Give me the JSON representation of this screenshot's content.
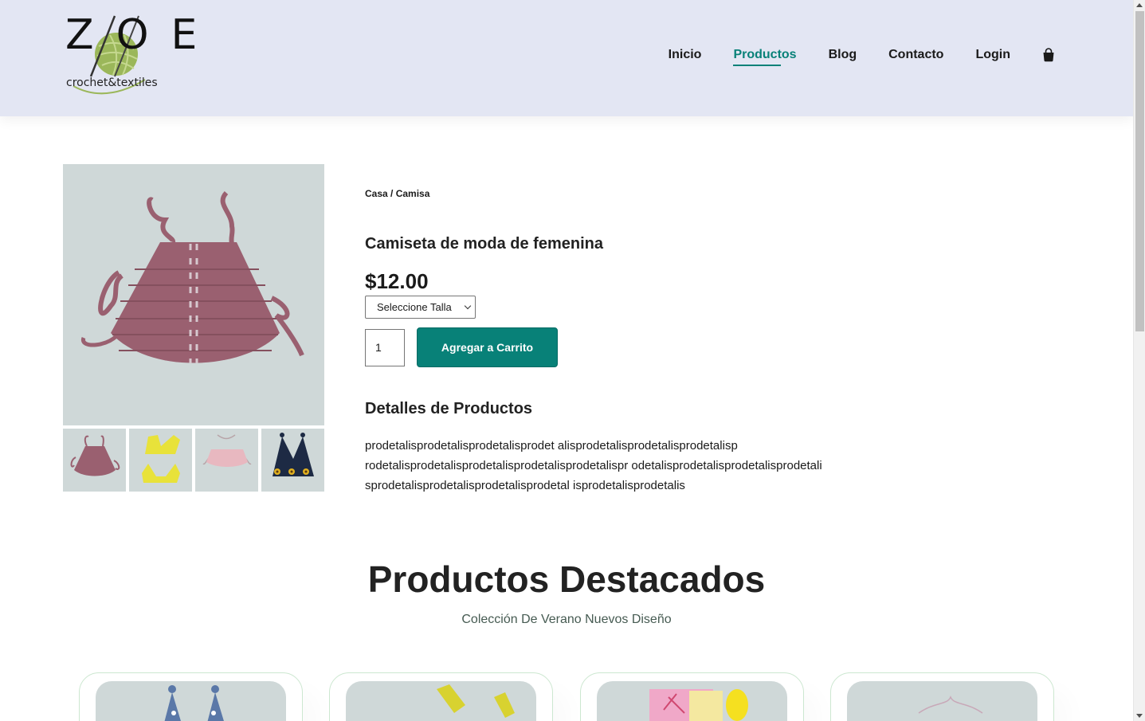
{
  "header": {
    "logo": {
      "main": "ZOE",
      "sub": "crochet&textiles"
    },
    "nav": [
      {
        "label": "Inicio",
        "active": false
      },
      {
        "label": "Productos",
        "active": true
      },
      {
        "label": "Blog",
        "active": false
      },
      {
        "label": "Contacto",
        "active": false
      },
      {
        "label": "Login",
        "active": false
      }
    ],
    "cart_icon": "shopping-bag-icon"
  },
  "product": {
    "breadcrumb": "Casa / Camisa",
    "title": "Camiseta de moda de femenina",
    "price": "$12.00",
    "size_select": "Seleccione Talla",
    "quantity": "1",
    "add_to_cart": "Agregar a Carrito",
    "details_heading": "Detalles de Productos",
    "details_text": "prodetalisprodetalisprodetalisprodet alisprodetalisprodetalisprodetalisp rodetalisprodetalisprodetalisprodetalisprodetalispr odetalisprodetalisprodetalisprodetali sprodetalisprodetalisprodetalisprodetal isprodetalisprodetalis"
  },
  "featured": {
    "title": "Productos Destacados",
    "subtitle": "Colección De Verano Nuevos Diseño"
  },
  "colors": {
    "accent": "#088178",
    "header_bg": "#e3e6f3",
    "product_bg": "#cfd8d8"
  }
}
